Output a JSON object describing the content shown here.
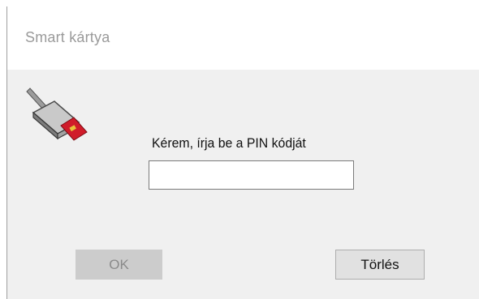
{
  "window": {
    "title": "Smart kártya"
  },
  "icon": {
    "name": "smart-card-reader-icon"
  },
  "dialog": {
    "prompt": "Kérem, írja be a PIN kódját",
    "pin_value": ""
  },
  "buttons": {
    "ok_label": "OK",
    "ok_enabled": false,
    "clear_label": "Törlés"
  },
  "colors": {
    "dialog_background": "#f0f0f0",
    "titlebar_background": "#ffffff",
    "title_text": "#9a9a9a",
    "disabled_button": "#cccccc",
    "card_red": "#d01c2a"
  }
}
